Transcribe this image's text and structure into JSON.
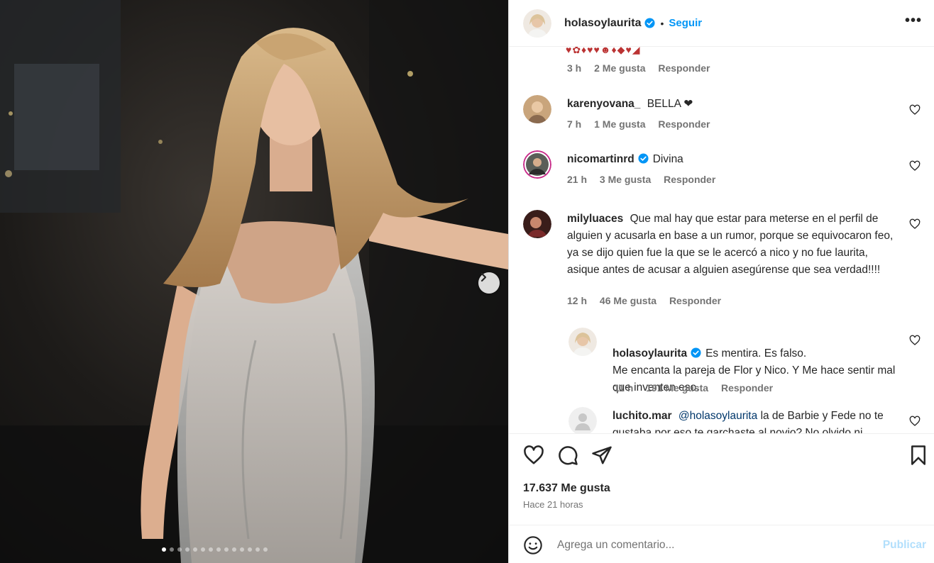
{
  "post": {
    "username": "holasoylaurita",
    "separator": "•",
    "follow_label": "Seguir",
    "more_label": "•••",
    "image_alt": "Mujer rubia con vestido plateado transparente",
    "carousel_count": 14,
    "carousel_active": 1
  },
  "top_comment": {
    "emojis": "♥✿♦♥♥☻♦◆♥◢",
    "time": "3 h",
    "likes": "2 Me gusta",
    "reply": "Responder"
  },
  "comments": [
    {
      "user": "karenyovana_",
      "text": "BELLA ❤",
      "time": "7 h",
      "likes": "1 Me gusta",
      "reply": "Responder",
      "verified": false
    },
    {
      "user": "nicomartinrd",
      "text": "Divina",
      "time": "21 h",
      "likes": "3 Me gusta",
      "reply": "Responder",
      "verified": true
    },
    {
      "user": "milyluaces",
      "text": "Que mal hay que estar para meterse en el perfil de alguien y acusarla en base a un rumor, porque se equivocaron feo, ya se dijo quien fue la que se le acercó a nico y no fue laurita, asique antes de acusar a alguien asegúrense que sea verdad!!!!",
      "time": "12 h",
      "likes": "46 Me gusta",
      "reply": "Responder",
      "verified": false
    }
  ],
  "replies": [
    {
      "user": "holasoylaurita",
      "text": "Es mentira. Es falso.\nMe encanta la pareja de Flor y Nico. Y Me hace sentir mal que inventen eso.",
      "time": "11 h",
      "likes": "191 Me gusta",
      "reply": "Responder",
      "verified": true
    },
    {
      "user": "luchito.mar",
      "mention": "@holasoylaurita",
      "text": "la de Barbie y Fede no te gustaba por eso te garchaste al novio? No olvido ni",
      "verified": false
    }
  ],
  "footer": {
    "likes_count": "17.637 Me gusta",
    "time_ago": "Hace 21 horas",
    "comment_placeholder": "Agrega un comentario...",
    "publish_label": "Publicar"
  },
  "colors": {
    "accent": "#0095f6",
    "verified": "#0095f6",
    "muted": "#737373",
    "text": "#262626"
  }
}
